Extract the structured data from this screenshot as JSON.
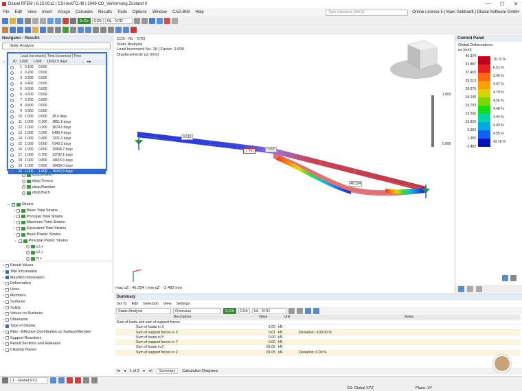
{
  "titlebar": {
    "text": "Dlubal RFEM | 6.15.0012 | CSI-testTD.rf6 | 2049-CD_Verformung Zustand II"
  },
  "menu": [
    "File",
    "Edit",
    "View",
    "Insert",
    "Assign",
    "Calculate",
    "Results",
    "Tools",
    "Options",
    "Window",
    "CAD-BIM",
    "Help"
  ],
  "search_placeholder": "Type a keyword (Alt+Q)",
  "license": "Online License 5 | Marc Gebhardt | Dlubal Software GmbH",
  "toolbar": {
    "combo": "CO5",
    "combo_desc": "NL - NTD",
    "combo_tag": "S-Ch"
  },
  "navigator": {
    "title": "Navigator - Results",
    "selector": "Static Analysis"
  },
  "popup": {
    "header": "Load Increment | Time Increment | Time",
    "current": {
      "n": "20",
      "a": "1.000",
      "b": "1.000",
      "c": "18262.5 days"
    },
    "rows": [
      {
        "n": "1",
        "a": "0.100",
        "b": "0.000",
        "c": ""
      },
      {
        "n": "2",
        "a": "0.200",
        "b": "0.000",
        "c": ""
      },
      {
        "n": "3",
        "a": "0.300",
        "b": "0.000",
        "c": ""
      },
      {
        "n": "4",
        "a": "0.400",
        "b": "0.000",
        "c": ""
      },
      {
        "n": "5",
        "a": "0.500",
        "b": "0.000",
        "c": ""
      },
      {
        "n": "6",
        "a": "0.600",
        "b": "0.000",
        "c": ""
      },
      {
        "n": "7",
        "a": "0.700",
        "b": "0.000",
        "c": ""
      },
      {
        "n": "8",
        "a": "0.800",
        "b": "0.000",
        "c": ""
      },
      {
        "n": "9",
        "a": "0.900",
        "b": "0.000",
        "c": ""
      },
      {
        "n": "10",
        "a": "1.000",
        "b": "0.000",
        "c": "28.0 days"
      },
      {
        "n": "11",
        "a": "1.000",
        "b": "0.100",
        "c": "1851.5 days"
      },
      {
        "n": "12",
        "a": "1.000",
        "b": "0.200",
        "c": "3674.0 days"
      },
      {
        "n": "13",
        "a": "1.000",
        "b": "0.300",
        "c": "5496.4 days"
      },
      {
        "n": "14",
        "a": "1.000",
        "b": "0.400",
        "c": "7321.0 days"
      },
      {
        "n": "15",
        "a": "1.000",
        "b": "0.500",
        "c": "9143.3 days"
      },
      {
        "n": "16",
        "a": "1.000",
        "b": "0.600",
        "c": "10968.7 days"
      },
      {
        "n": "17",
        "a": "1.000",
        "b": "0.700",
        "c": "12792.1 days"
      },
      {
        "n": "18",
        "a": "1.000",
        "b": "0.800",
        "c": "14615.6 days"
      },
      {
        "n": "19",
        "a": "1.000",
        "b": "0.900",
        "c": "16439.0 days"
      },
      {
        "n": "20",
        "a": "1.000",
        "b": "1.000",
        "c": "18262.5 days"
      }
    ]
  },
  "tree_upper": [
    "εbop,Mises,-",
    "εbop,Tresca",
    "εbop,Rankine",
    "εbop,Bach"
  ],
  "tree_strains": [
    "Strains",
    "Basic Total Strains",
    "Principal Total Strains",
    "Maximum Total Strains",
    "Equivalent Total Strains",
    "Basic Plastic Strains",
    "Principal Plastic Strains"
  ],
  "tree_pp": [
    "ε1,+",
    "ε2,+",
    "α,+"
  ],
  "tree_bottom": [
    "Result Values",
    "Title Information",
    "Max/Min Information",
    "Deformation",
    "Lines",
    "Members",
    "Surfaces",
    "Solids",
    "Values on Surfaces",
    "Dimension",
    "Type of display",
    "Ribs - Effective Contribution on Surface/Member",
    "Support Reactions",
    "Result Sections and Releases",
    "Clipping Planes"
  ],
  "view": {
    "l1": "CO5 - NL - NTD",
    "l2": "Static Analysis",
    "l3": "Load Increment No. 10 | Factor: 1.000",
    "l4": "Displacements uZ [mm]",
    "maxmin": "max uZ : 46.324 | min uZ : -2.482 mm",
    "lab1": "0.519",
    "lab2": "-2.482",
    "lab3": "0.000",
    "lab4": "46.324",
    "lab5": "1.000",
    "lab6": "0.000"
  },
  "control_panel": {
    "title": "Control Panel",
    "sub1": "Global Deformations",
    "sub2": "uz [mm]",
    "values": [
      "46.324",
      "41.887",
      "37.450",
      "33.013",
      "28.576",
      "24.140",
      "19.703",
      "15.266",
      "10.829",
      "6.392",
      "1.955",
      "-2.482"
    ],
    "percents": [
      "15.70 %",
      "6.51 %",
      "3.46 %",
      "4.97 %",
      "4.70 %",
      "4.56 %",
      "4.48 %",
      "4.44 %",
      "4.49 %",
      "4.55 %",
      "42.18 %"
    ],
    "colors": [
      "#c0001a",
      "#e82020",
      "#ff6a10",
      "#ffa000",
      "#d4d400",
      "#7ed800",
      "#10e010",
      "#00d8a0",
      "#00a8e8",
      "#1060ff",
      "#0a10c0"
    ]
  },
  "summary": {
    "title": "Summary",
    "menu": [
      "Go To",
      "Edit",
      "Selection",
      "View",
      "Settings"
    ],
    "selector": "Static Analysis",
    "overview": "Overview",
    "combo": "CO5",
    "combo_desc": "NL - NTD",
    "cols": [
      "Description",
      "Value",
      "Unit",
      "Notes"
    ],
    "group": "Sum of loads and sum of support forces",
    "rows": [
      {
        "d": "Sum of loads in X",
        "v": "0.00",
        "u": "kN",
        "n": ""
      },
      {
        "d": "Sum of support forces in X",
        "v": "0.01",
        "u": "kN",
        "n": "Deviation: -100.00 %"
      },
      {
        "d": "Sum of loads in Y",
        "v": "0.00",
        "u": "kN",
        "n": ""
      },
      {
        "d": "Sum of support forces in Y",
        "v": "0.00",
        "u": "kN",
        "n": ""
      },
      {
        "d": "Sum of loads in Z",
        "v": "81.05",
        "u": "kN",
        "n": ""
      },
      {
        "d": "Sum of support forces in Z",
        "v": "81.05",
        "u": "kN",
        "n": "Deviation: 0.00 %"
      }
    ],
    "page": "1 of 2",
    "tabs": [
      "Summary",
      "Calculation Diagrams"
    ]
  },
  "status": {
    "cs": "1 - Global XYZ",
    "cs2": "CS: Global XYZ",
    "plane": "Plane: XY"
  }
}
